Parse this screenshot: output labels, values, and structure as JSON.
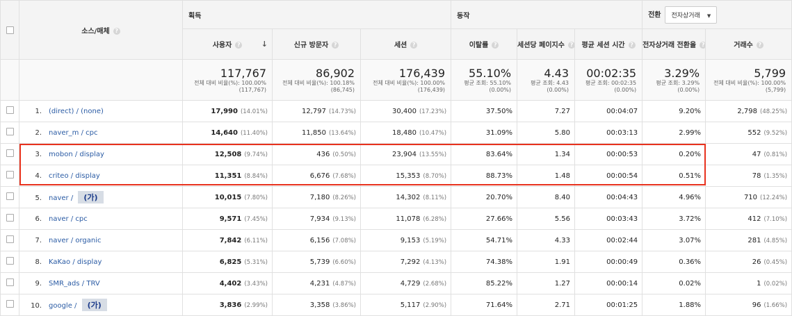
{
  "header": {
    "source_medium": "소스/매체",
    "groups": {
      "acquisition": "획득",
      "behavior": "동작",
      "conversion": "전환"
    },
    "conversion_select": "전자상거래",
    "columns": [
      "사용자",
      "신규 방문자",
      "세션",
      "이탈률",
      "세션당 페이지수",
      "평균 세션 시간",
      "전자상거래 전환율",
      "거래수"
    ],
    "help_glyph": "?",
    "sort_glyph": "↓"
  },
  "totals": [
    {
      "big": "117,767",
      "small": "전체 대비 비율(%): 100.00% (117,767)"
    },
    {
      "big": "86,902",
      "small": "전체 대비 비율(%): 100.18% (86,745)"
    },
    {
      "big": "176,439",
      "small": "전체 대비 비율(%): 100.00% (176,439)"
    },
    {
      "big": "55.10%",
      "small": "평균 조회: 55.10% (0.00%)"
    },
    {
      "big": "4.43",
      "small": "평균 조회: 4.43 (0.00%)"
    },
    {
      "big": "00:02:35",
      "small": "평균 조회: 00:02:35 (0.00%)"
    },
    {
      "big": "3.29%",
      "small": "평균 조회: 3.29% (0.00%)"
    },
    {
      "big": "5,799",
      "small": "전체 대비 비율(%): 100.00% (5,799)"
    }
  ],
  "rows": [
    {
      "num": "1.",
      "src": "(direct) / (none)",
      "badge": "",
      "users": "17,990",
      "users_pct": "(14.01%)",
      "new": "12,797",
      "new_pct": "(14.73%)",
      "sessions": "30,400",
      "sessions_pct": "(17.23%)",
      "bounce": "37.50%",
      "pps": "7.27",
      "dur": "00:04:07",
      "conv": "9.20%",
      "tx": "2,798",
      "tx_pct": "(48.25%)"
    },
    {
      "num": "2.",
      "src": "naver_m / cpc",
      "badge": "",
      "users": "14,640",
      "users_pct": "(11.40%)",
      "new": "11,850",
      "new_pct": "(13.64%)",
      "sessions": "18,480",
      "sessions_pct": "(10.47%)",
      "bounce": "31.09%",
      "pps": "5.80",
      "dur": "00:03:13",
      "conv": "2.99%",
      "tx": "552",
      "tx_pct": "(9.52%)"
    },
    {
      "num": "3.",
      "src": "mobon / display",
      "badge": "",
      "users": "12,508",
      "users_pct": "(9.74%)",
      "new": "436",
      "new_pct": "(0.50%)",
      "sessions": "23,904",
      "sessions_pct": "(13.55%)",
      "bounce": "83.64%",
      "pps": "1.34",
      "dur": "00:00:53",
      "conv": "0.20%",
      "tx": "47",
      "tx_pct": "(0.81%)"
    },
    {
      "num": "4.",
      "src": "criteo / display",
      "badge": "",
      "users": "11,351",
      "users_pct": "(8.84%)",
      "new": "6,676",
      "new_pct": "(7.68%)",
      "sessions": "15,353",
      "sessions_pct": "(8.70%)",
      "bounce": "88.73%",
      "pps": "1.48",
      "dur": "00:00:54",
      "conv": "0.51%",
      "tx": "78",
      "tx_pct": "(1.35%)"
    },
    {
      "num": "5.",
      "src": "naver / ",
      "badge": "(가)",
      "users": "10,015",
      "users_pct": "(7.80%)",
      "new": "7,180",
      "new_pct": "(8.26%)",
      "sessions": "14,302",
      "sessions_pct": "(8.11%)",
      "bounce": "20.70%",
      "pps": "8.40",
      "dur": "00:04:43",
      "conv": "4.96%",
      "tx": "710",
      "tx_pct": "(12.24%)"
    },
    {
      "num": "6.",
      "src": "naver / cpc",
      "badge": "",
      "users": "9,571",
      "users_pct": "(7.45%)",
      "new": "7,934",
      "new_pct": "(9.13%)",
      "sessions": "11,078",
      "sessions_pct": "(6.28%)",
      "bounce": "27.66%",
      "pps": "5.56",
      "dur": "00:03:43",
      "conv": "3.72%",
      "tx": "412",
      "tx_pct": "(7.10%)"
    },
    {
      "num": "7.",
      "src": "naver / organic",
      "badge": "",
      "users": "7,842",
      "users_pct": "(6.11%)",
      "new": "6,156",
      "new_pct": "(7.08%)",
      "sessions": "9,153",
      "sessions_pct": "(5.19%)",
      "bounce": "54.71%",
      "pps": "4.33",
      "dur": "00:02:44",
      "conv": "3.07%",
      "tx": "281",
      "tx_pct": "(4.85%)"
    },
    {
      "num": "8.",
      "src": "KaKao / display",
      "badge": "",
      "users": "6,825",
      "users_pct": "(5.31%)",
      "new": "5,739",
      "new_pct": "(6.60%)",
      "sessions": "7,292",
      "sessions_pct": "(4.13%)",
      "bounce": "74.38%",
      "pps": "1.91",
      "dur": "00:00:49",
      "conv": "0.36%",
      "tx": "26",
      "tx_pct": "(0.45%)"
    },
    {
      "num": "9.",
      "src": "SMR_ads / TRV",
      "badge": "",
      "users": "4,402",
      "users_pct": "(3.43%)",
      "new": "4,231",
      "new_pct": "(4.87%)",
      "sessions": "4,729",
      "sessions_pct": "(2.68%)",
      "bounce": "85.22%",
      "pps": "1.27",
      "dur": "00:00:14",
      "conv": "0.02%",
      "tx": "1",
      "tx_pct": "(0.02%)"
    },
    {
      "num": "10.",
      "src": "google / ",
      "badge": "(가)",
      "users": "3,836",
      "users_pct": "(2.99%)",
      "new": "3,358",
      "new_pct": "(3.86%)",
      "sessions": "5,117",
      "sessions_pct": "(2.90%)",
      "bounce": "71.64%",
      "pps": "2.71",
      "dur": "00:01:25",
      "conv": "1.88%",
      "tx": "96",
      "tx_pct": "(1.66%)"
    }
  ],
  "colors": {
    "highlight": "#e8321e",
    "link": "#2a5ba4"
  }
}
